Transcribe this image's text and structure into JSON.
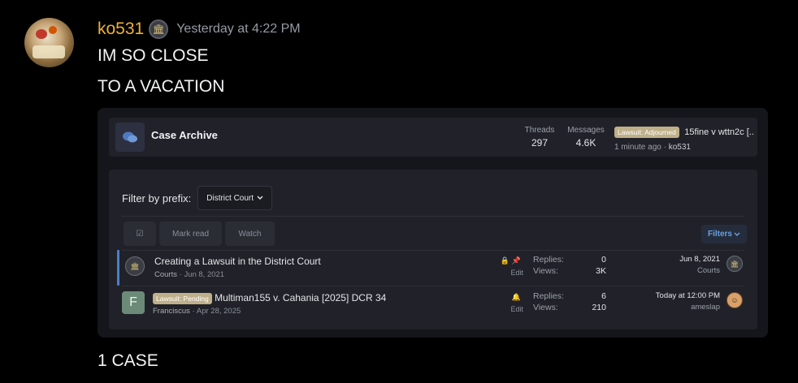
{
  "message": {
    "author": "ko531",
    "timestamp": "Yesterday at 4:22 PM",
    "lines": [
      "IM SO CLOSE",
      "TO A VACATION"
    ],
    "after_text": "1 CASE"
  },
  "embed": {
    "node": {
      "title": "Case Archive",
      "threads_label": "Threads",
      "threads_value": "297",
      "messages_label": "Messages",
      "messages_value": "4.6K",
      "latest_prefix": "Lawsuit: Adjourned",
      "latest_title": "15fine v wttn2c [...",
      "latest_time": "1 minute ago",
      "latest_sep": "·",
      "latest_user": "ko531"
    },
    "filter": {
      "label": "Filter by prefix:",
      "value": "District Court"
    },
    "toolbar": {
      "select_icon": "☑",
      "mark_read": "Mark read",
      "watch": "Watch",
      "filters": "Filters"
    },
    "threads": [
      {
        "title": "Creating a Lawsuit in the District Court",
        "author": "Courts",
        "date": "Jun 8, 2021",
        "edit": "Edit",
        "replies_label": "Replies:",
        "replies": "0",
        "views_label": "Views:",
        "views": "3K",
        "last_date": "Jun 8, 2021",
        "last_user": "Courts"
      },
      {
        "letter": "F",
        "prefix": "Lawsuit: Pending",
        "title": "Multiman155 v. Cahania [2025] DCR 34",
        "author": "Franciscus",
        "date": "Apr 28, 2025",
        "edit": "Edit",
        "replies_label": "Replies:",
        "replies": "6",
        "views_label": "Views:",
        "views": "210",
        "last_date": "Today at 12:00 PM",
        "last_user": "ameslap"
      }
    ]
  },
  "colors": {
    "username": "#f0b132",
    "accent_blue": "#4a7ec8",
    "prefix_bg": "#bfb08a"
  },
  "icons": [
    "courthouse-icon",
    "chat-bubbles-icon",
    "lock-icon",
    "pin-icon",
    "bell-icon",
    "chevron-down-icon",
    "checkbox-icon"
  ]
}
